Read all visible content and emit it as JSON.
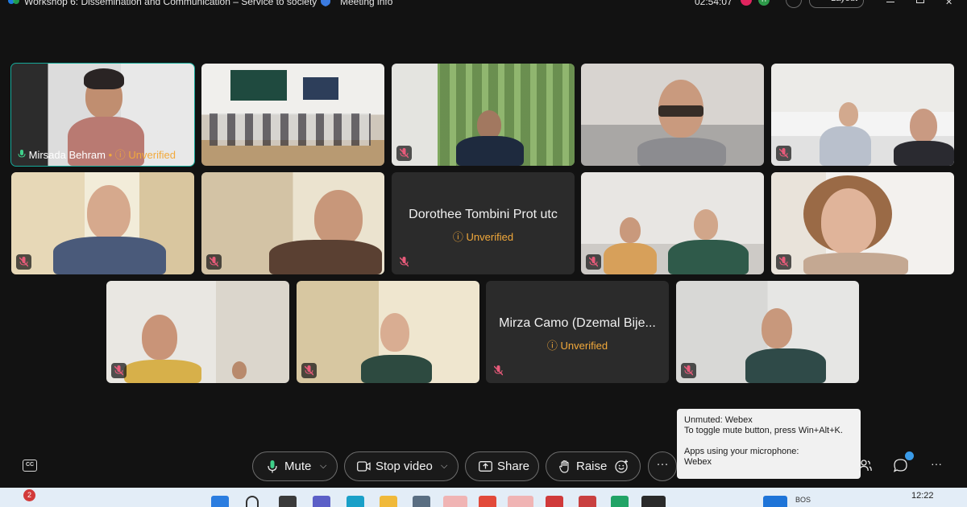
{
  "window": {
    "title": "Workshop 6: Dissemination and Communication – Service to society",
    "meeting_info": "Meeting info",
    "timer": "02:54:07",
    "layout_label": "Layout",
    "green_badge": "H"
  },
  "participants": [
    {
      "name": "Mirsada Behram",
      "status": "Unverified",
      "active_speaker": true,
      "muted": false
    },
    {
      "name": "",
      "muted": false
    },
    {
      "name": "",
      "muted": true
    },
    {
      "name": "",
      "muted": false
    },
    {
      "name": "",
      "muted": true
    },
    {
      "name": "",
      "muted": true
    },
    {
      "name": "",
      "muted": true
    },
    {
      "name": "Dorothee Tombini Prot utc",
      "status": "Unverified",
      "video_off": true,
      "muted": true
    },
    {
      "name": "",
      "muted": true
    },
    {
      "name": "",
      "muted": true
    },
    {
      "name": "",
      "muted": true
    },
    {
      "name": "",
      "muted": true
    },
    {
      "name": "Mirza Camo (Dzemal Bije...",
      "status": "Unverified",
      "video_off": true,
      "muted": true
    },
    {
      "name": "",
      "muted": true
    }
  ],
  "tooltip": {
    "line1": "Unmuted: Webex",
    "line2": "To toggle mute button, press Win+Alt+K.",
    "line3": "Apps using your microphone:",
    "line4": "Webex"
  },
  "controls": {
    "cc": "CC",
    "mute": "Mute",
    "stop_video": "Stop video",
    "share": "Share",
    "raise": "Raise",
    "more": "···"
  },
  "taskbar": {
    "notification_count": "2",
    "lang": "BOS",
    "time": "12:22"
  },
  "icons": [
    "webex-logo-icon",
    "shield-icon",
    "search-icon",
    "layout-icon",
    "mic-icon",
    "mic-off-icon",
    "camera-icon",
    "share-icon",
    "hand-icon",
    "emoji-icon",
    "chat-icon",
    "participants-icon",
    "more-icon"
  ],
  "colors": {
    "accent_active": "#16a999",
    "unverified": "#f2a93b",
    "background": "#121212"
  }
}
